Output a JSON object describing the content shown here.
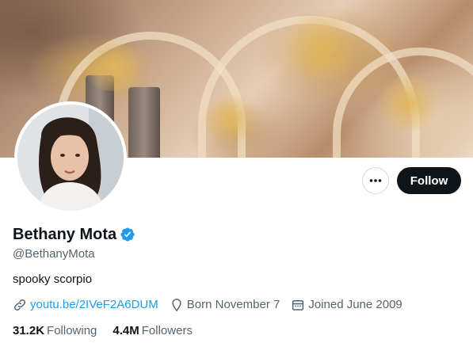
{
  "profile": {
    "name": "Bethany Mota",
    "handle": "@BethanyMota",
    "bio": "spooky scorpio",
    "link": "youtu.be/2IVeF2A6DUM",
    "born": "Born November 7",
    "joined": "Joined June 2009"
  },
  "actions": {
    "follow_label": "Follow"
  },
  "stats": {
    "following_count": "31.2K",
    "following_label": "Following",
    "followers_count": "4.4M",
    "followers_label": "Followers"
  },
  "colors": {
    "accent": "#1d9bf0",
    "text": "#0f1419",
    "secondary_text": "#536471",
    "follow_button_bg": "#0f1419"
  },
  "icons": [
    "more-icon",
    "verified-badge-icon",
    "link-icon",
    "location-pin-icon",
    "calendar-icon"
  ]
}
